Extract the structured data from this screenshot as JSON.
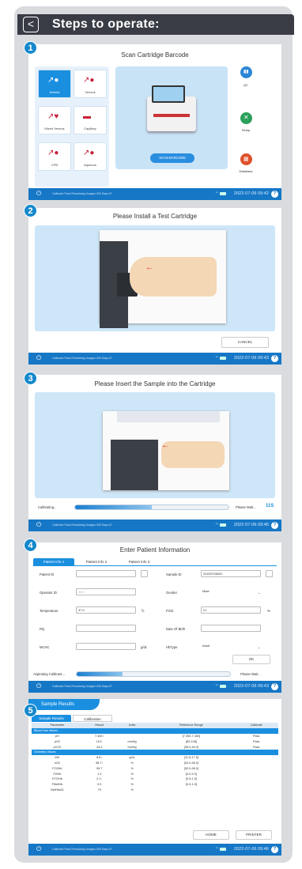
{
  "header": {
    "title": "Steps to operate:",
    "back": "<"
  },
  "steps": [
    "1",
    "2",
    "3",
    "4",
    "5"
  ],
  "status": {
    "text": "Calibrant Pack Remaining Usages:295 Days:3?",
    "power": "⏻",
    "help": "?"
  },
  "dates": [
    "2022-07-06 09:42",
    "2022-07-06 09:43",
    "2022-07-06 09:45",
    "2022-07-06 09:43",
    "2022-07-06 09:46"
  ],
  "s1": {
    "title": "Scan Cartridge Barcode",
    "tiles": [
      {
        "label": "Arterial",
        "icon": "syringe-drop-icon"
      },
      {
        "label": "Venous",
        "icon": "syringe-drop-icon"
      },
      {
        "label": "Mixed Venous",
        "icon": "syringe-heart-icon"
      },
      {
        "label": "Capillary",
        "icon": "capillary-tube-icon"
      },
      {
        "label": "CPB",
        "icon": "syringe-drop-icon"
      },
      {
        "label": "Aqueous",
        "icon": "syringe-drop-icon"
      }
    ],
    "scan": "SCAN BARCODE",
    "side": [
      {
        "label": "QC",
        "color": "#2b86d6"
      },
      {
        "label": "Setup",
        "color": "#2aa05a"
      },
      {
        "label": "Database",
        "color": "#e0502a"
      }
    ]
  },
  "s2": {
    "title": "Please Install a Test Cartridge",
    "cancel": "CANCEL"
  },
  "s3": {
    "title": "Please Insert the Sample into the Cartridge",
    "calibrating": "Calibrating...",
    "wait": "Please Wait...",
    "timer": "11S",
    "progress": 0.5
  },
  "s4": {
    "title": "Enter Patient Information",
    "tabs": [
      "Patient Info 1",
      "Patient Info 2",
      "Patient Info 3"
    ],
    "left": [
      {
        "label": "Patient ID",
        "value": "",
        "unit": ""
      },
      {
        "label": "Operator ID",
        "value": "Infin",
        "unit": ""
      },
      {
        "label": "Temperature",
        "value": "37.0",
        "unit": "°C"
      },
      {
        "label": "RQ",
        "value": "",
        "unit": ""
      },
      {
        "label": "MCHC",
        "value": "",
        "unit": "g/dL"
      }
    ],
    "right": [
      {
        "label": "Sample ID",
        "value": "20220706001",
        "unit": ""
      },
      {
        "label": "Gender",
        "value": "Male",
        "unit": ""
      },
      {
        "label": "FIO2",
        "value": "21",
        "unit": "%"
      },
      {
        "label": "Date Of Birth",
        "value": "",
        "unit": ""
      },
      {
        "label": "HbType",
        "value": "Adult",
        "unit": ""
      }
    ],
    "ok": "OK",
    "aspirating": "Aspirating Calibrant...",
    "wait": "Please Wait...",
    "progress": 0.3
  },
  "s5": {
    "title": "Sample Results",
    "tabs": [
      "Sample Results",
      "Calibration"
    ],
    "cols": [
      "Parameter",
      "Result",
      "Units",
      "Reference Range",
      "Calibrate"
    ],
    "groups": [
      {
        "name": "Blood Gas Values",
        "rows": [
          [
            "pH",
            "7.463↑",
            "",
            "[7.350-7.450]",
            "Pass"
          ],
          [
            "pO2",
            "113↑",
            "mmHg",
            "[83-108]",
            "Pass"
          ],
          [
            "pCO2",
            "44.4",
            "mmHg",
            "[35.0-45.0]",
            "Pass"
          ]
        ]
      },
      {
        "name": "Oximetry Values",
        "rows": [
          [
            "tHb",
            "8.8↓",
            "g/dL",
            "[11.5-17.5]",
            ""
          ],
          [
            "sO2",
            "98.7↑",
            "%",
            "[94.0-98.0]",
            ""
          ],
          [
            "FO2Hb",
            "95.7",
            "%",
            "[92.0-98.0]",
            ""
          ],
          [
            "FHHb",
            "1.3",
            "%",
            "[0.0-5.0]",
            ""
          ],
          [
            "FCOHb",
            "2.1↑",
            "%",
            "[0.5-1.5]",
            ""
          ],
          [
            "FMetHb",
            "0.9",
            "%",
            "[0.0-1.5]",
            ""
          ],
          [
            "NetHbs01",
            "79",
            "%",
            "",
            ""
          ]
        ]
      }
    ],
    "home": "HOME",
    "printer": "PRINTER"
  }
}
